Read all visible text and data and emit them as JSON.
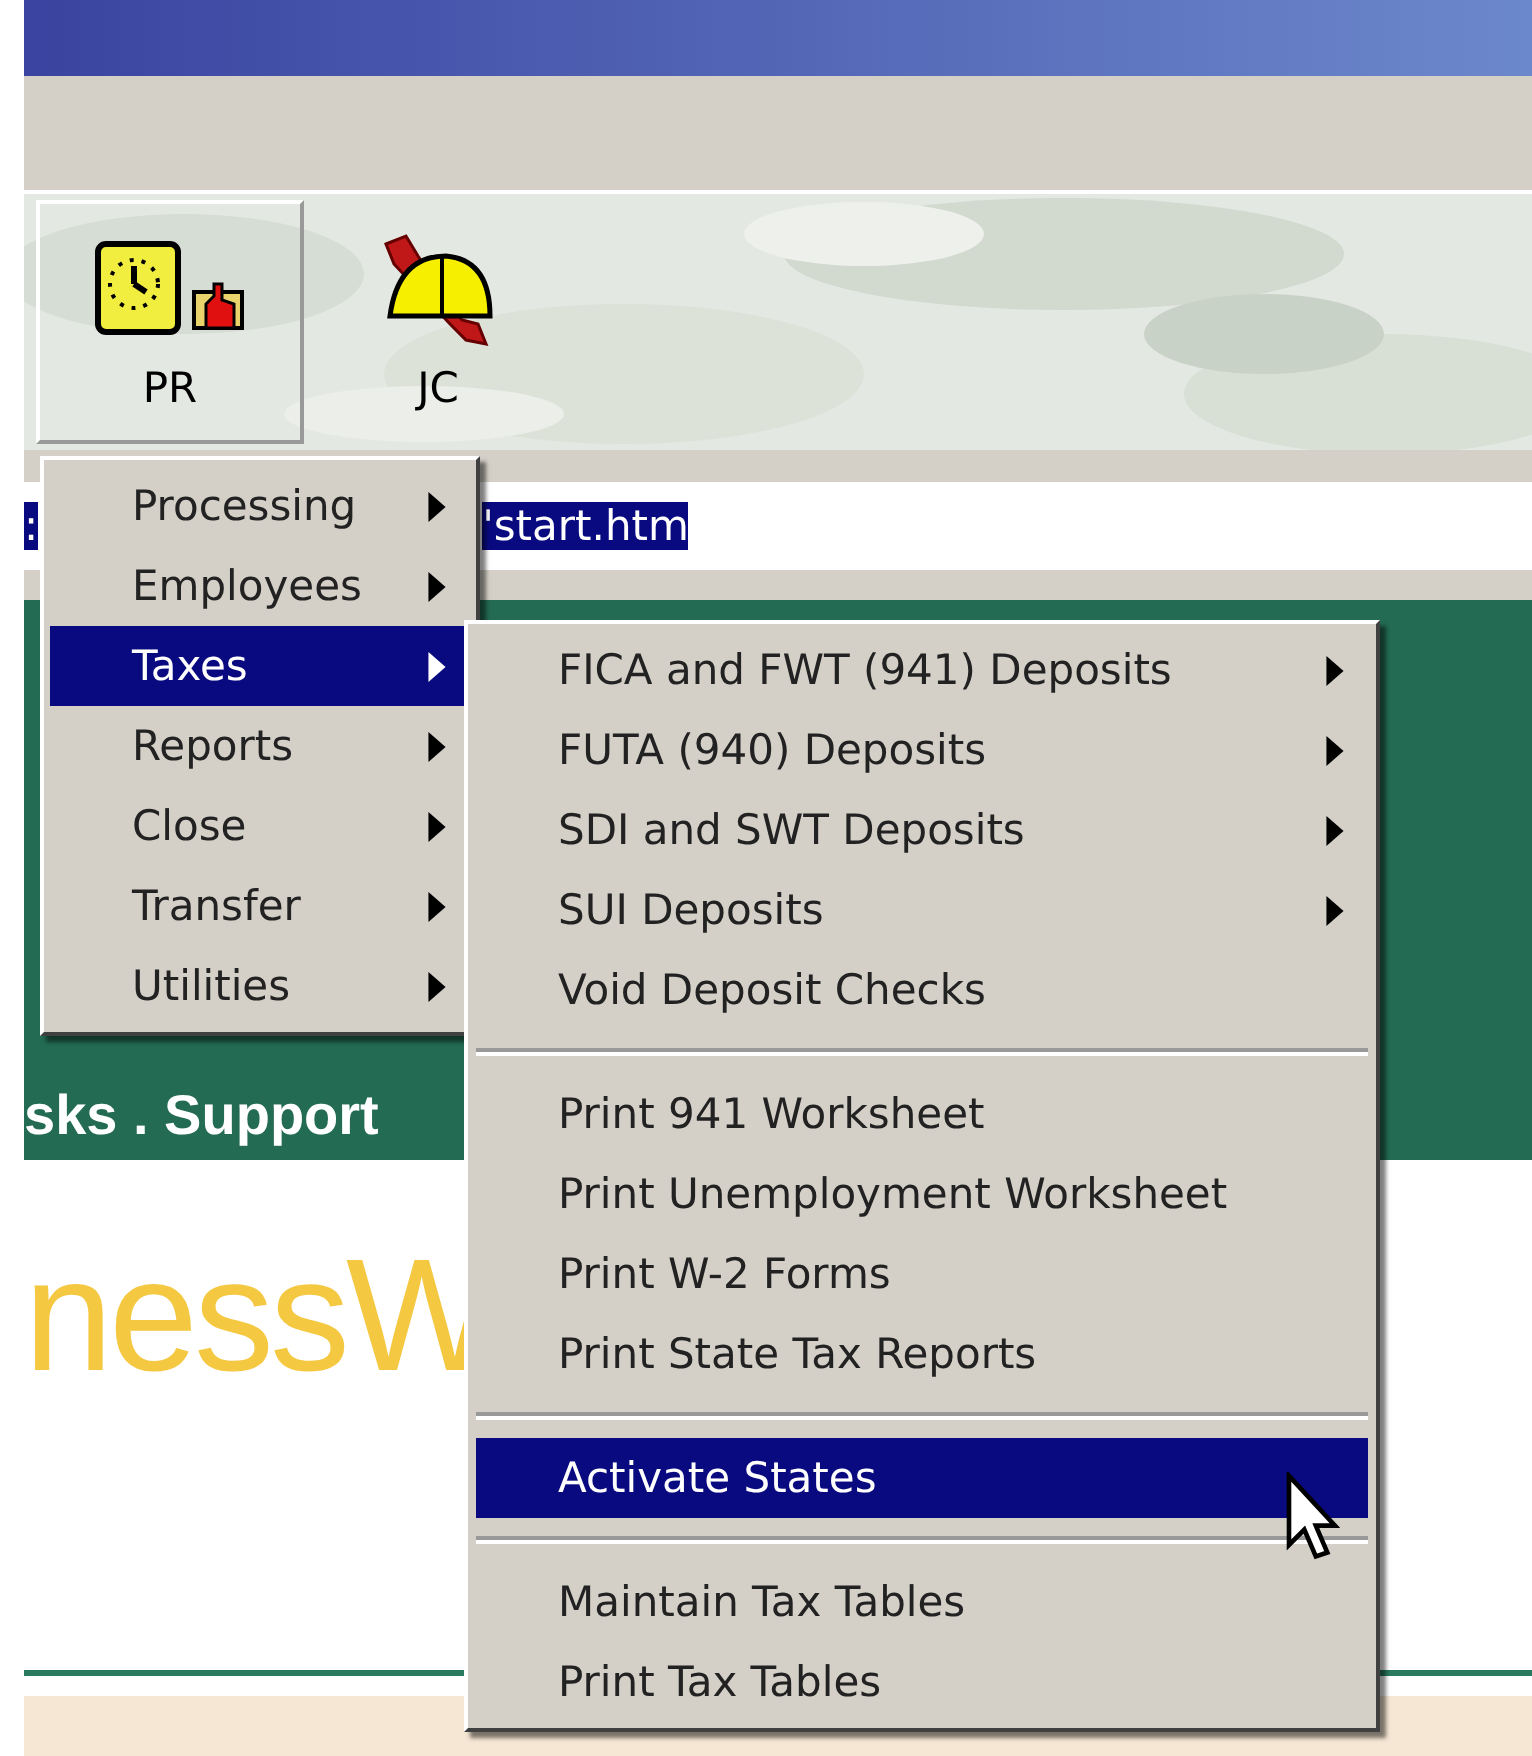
{
  "toolbar": {
    "buttons": [
      {
        "label": "PR",
        "selected": true
      },
      {
        "label": "JC",
        "selected": false
      }
    ]
  },
  "address_bar": {
    "prefix": ":",
    "value": "'start.htm"
  },
  "page": {
    "nav_text": "sks . Support",
    "logo_text": "nessW"
  },
  "menu": {
    "items": [
      {
        "label": "Processing",
        "selected": false,
        "submenu": true
      },
      {
        "label": "Employees",
        "selected": false,
        "submenu": true
      },
      {
        "label": "Taxes",
        "selected": true,
        "submenu": true
      },
      {
        "label": "Reports",
        "selected": false,
        "submenu": true
      },
      {
        "label": "Close",
        "selected": false,
        "submenu": true
      },
      {
        "label": "Transfer",
        "selected": false,
        "submenu": true
      },
      {
        "label": "Utilities",
        "selected": false,
        "submenu": true
      }
    ]
  },
  "submenu": {
    "items": [
      {
        "kind": "item",
        "label": "FICA and FWT (941) Deposits",
        "selected": false,
        "submenu": true
      },
      {
        "kind": "item",
        "label": "FUTA (940) Deposits",
        "selected": false,
        "submenu": true
      },
      {
        "kind": "item",
        "label": "SDI and SWT Deposits",
        "selected": false,
        "submenu": true
      },
      {
        "kind": "item",
        "label": "SUI Deposits",
        "selected": false,
        "submenu": true
      },
      {
        "kind": "item",
        "label": "Void Deposit Checks",
        "selected": false,
        "submenu": false
      },
      {
        "kind": "separator"
      },
      {
        "kind": "item",
        "label": "Print 941 Worksheet",
        "selected": false,
        "submenu": false
      },
      {
        "kind": "item",
        "label": "Print Unemployment Worksheet",
        "selected": false,
        "submenu": false
      },
      {
        "kind": "item",
        "label": "Print W-2 Forms",
        "selected": false,
        "submenu": false
      },
      {
        "kind": "item",
        "label": "Print State Tax Reports",
        "selected": false,
        "submenu": false
      },
      {
        "kind": "separator"
      },
      {
        "kind": "item",
        "label": "Activate States",
        "selected": true,
        "submenu": false
      },
      {
        "kind": "separator"
      },
      {
        "kind": "item",
        "label": "Maintain Tax Tables",
        "selected": false,
        "submenu": false
      },
      {
        "kind": "item",
        "label": "Print Tax Tables",
        "selected": false,
        "submenu": false
      }
    ]
  }
}
